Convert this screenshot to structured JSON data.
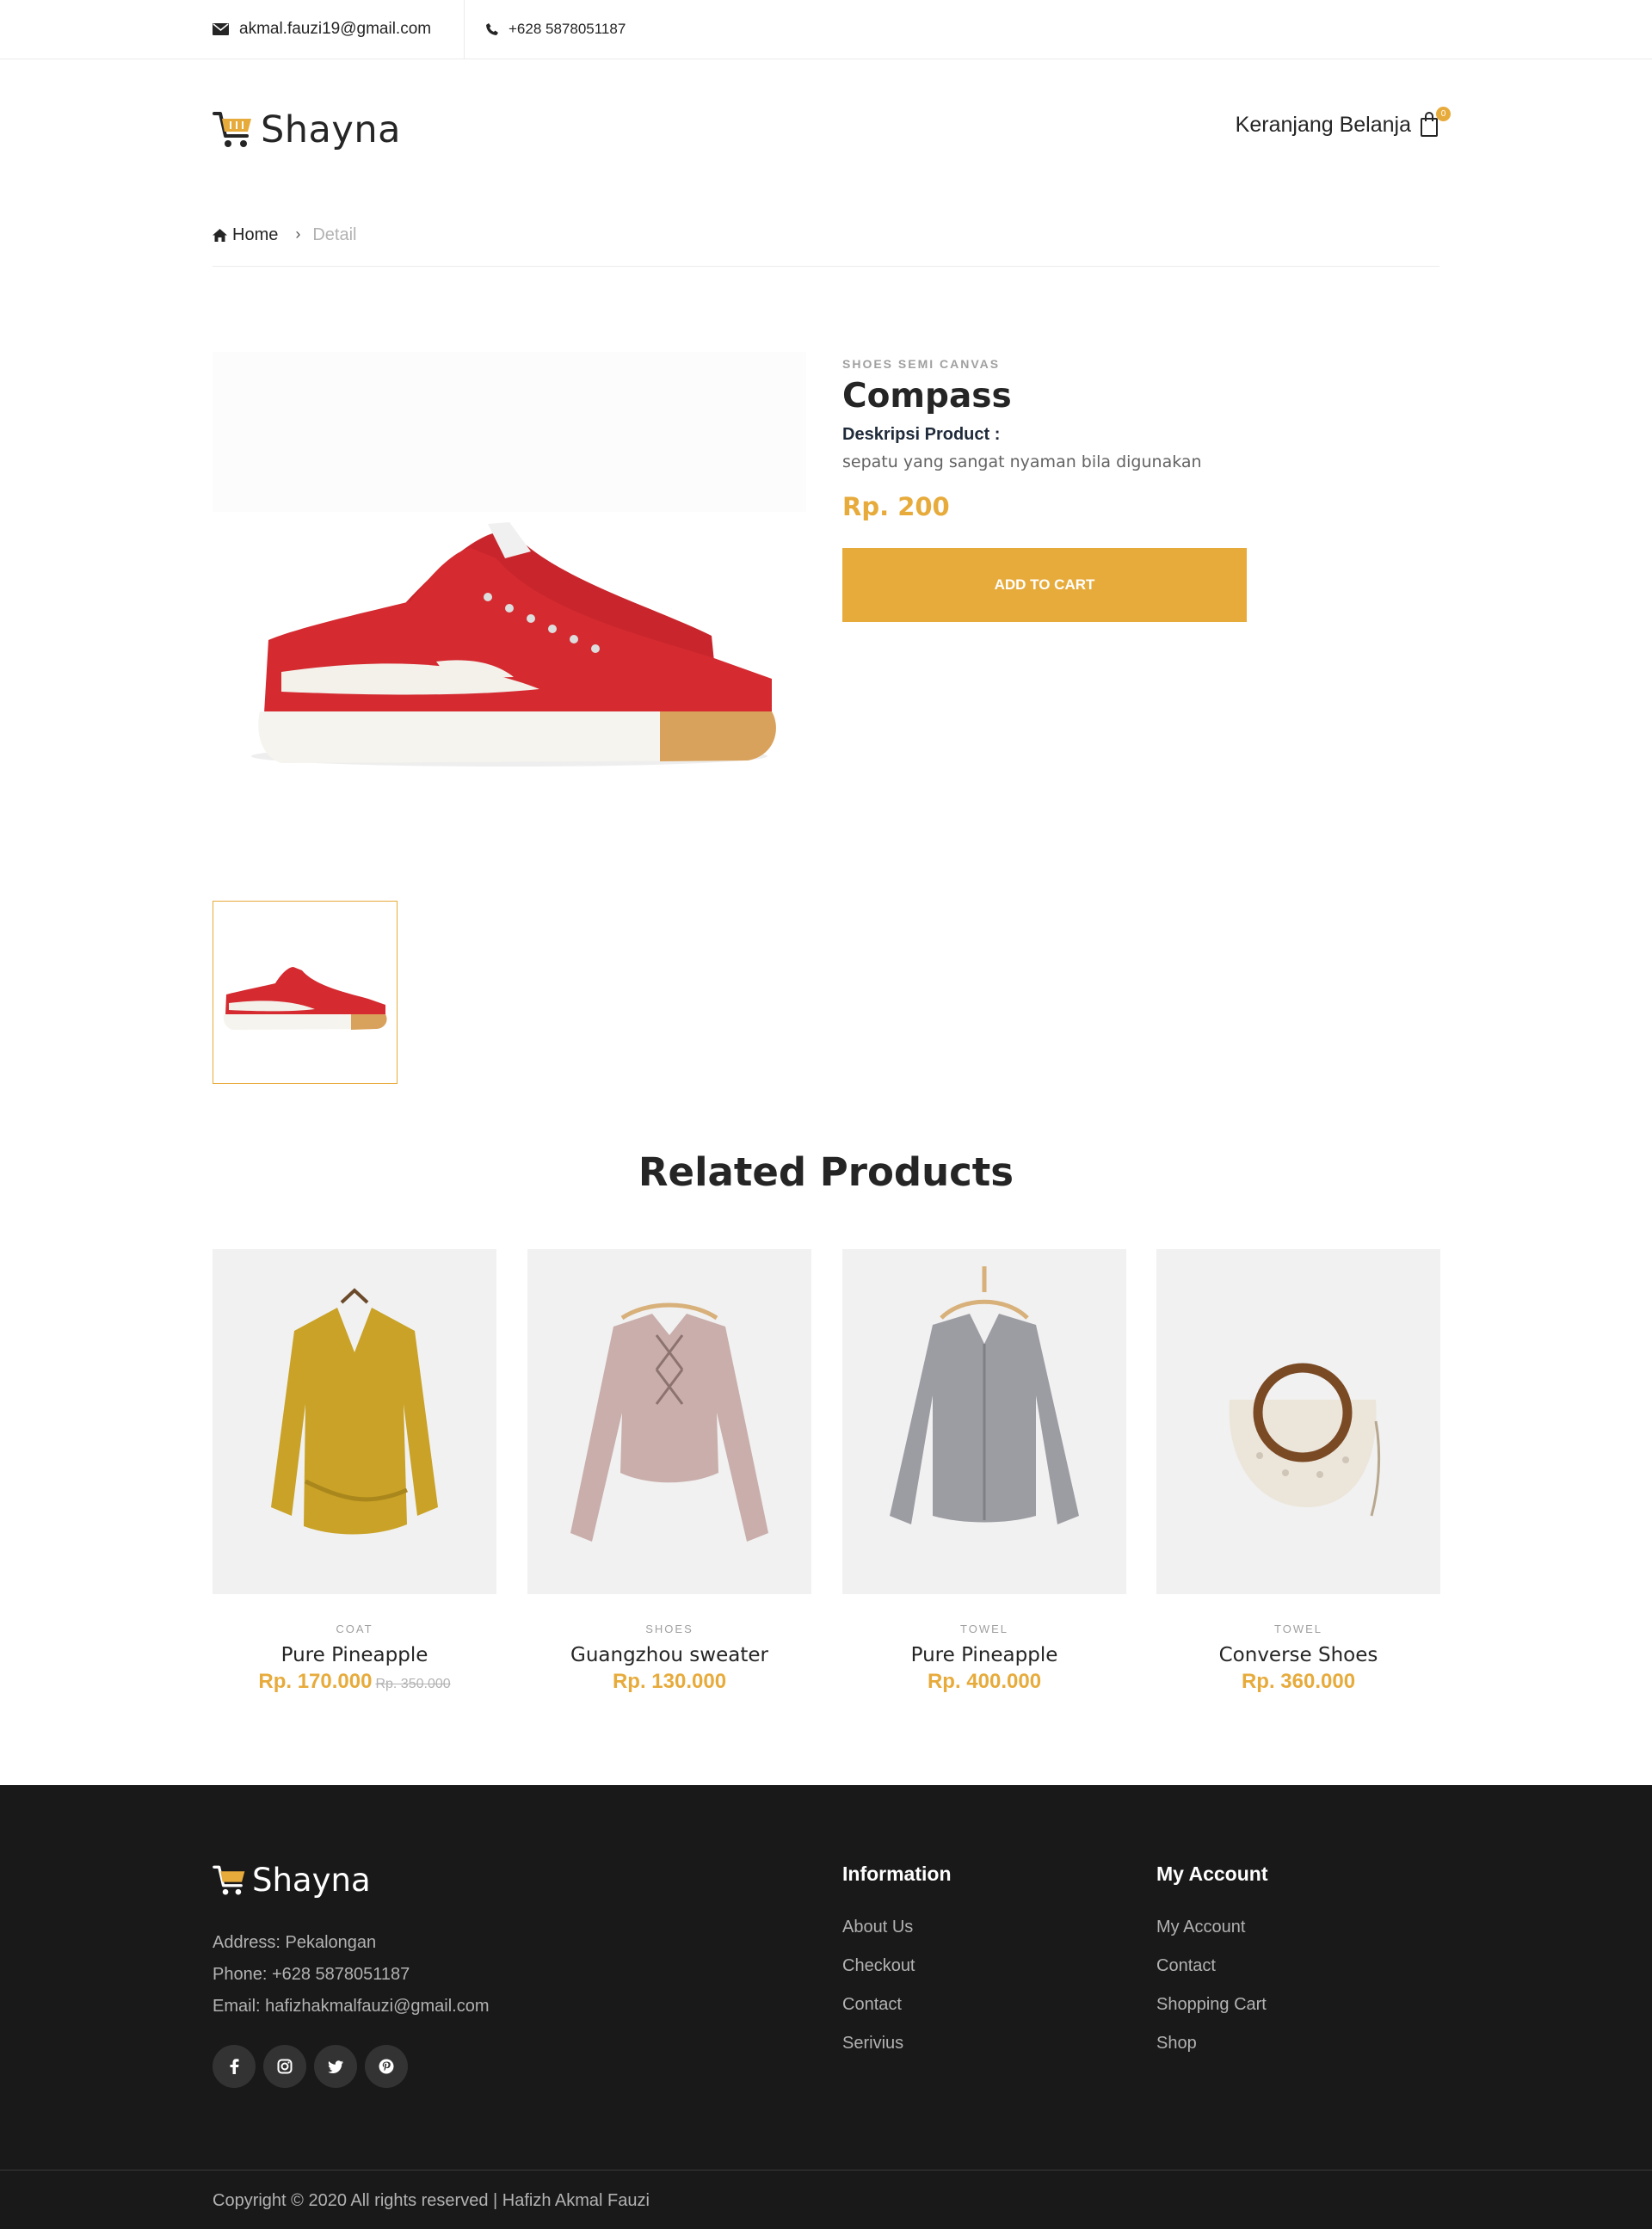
{
  "topbar": {
    "email": "akmal.fauzi19@gmail.com",
    "phone": "+628 5878051187",
    "email_icon": "envelope-icon",
    "phone_icon": "phone-icon"
  },
  "header": {
    "brand": "Shayna",
    "cart_label": "Keranjang Belanja",
    "cart_count": "0"
  },
  "breadcrumb": {
    "home": "Home",
    "current": "Detail"
  },
  "product": {
    "category": "SHOES SEMI CANVAS",
    "title": "Compass",
    "desc_label": "Deskripsi Product :",
    "description": "sepatu yang sangat nyaman bila digunakan",
    "price": "Rp. 200",
    "add_to_cart": "ADD TO CART"
  },
  "related": {
    "title": "Related Products",
    "items": [
      {
        "category": "COAT",
        "name": "Pure Pineapple",
        "price": "Rp. 170.000",
        "old_price": "Rp. 350.000"
      },
      {
        "category": "SHOES",
        "name": "Guangzhou sweater",
        "price": "Rp. 130.000"
      },
      {
        "category": "TOWEL",
        "name": "Pure Pineapple",
        "price": "Rp. 400.000"
      },
      {
        "category": "TOWEL",
        "name": "Converse Shoes",
        "price": "Rp. 360.000"
      }
    ]
  },
  "footer": {
    "brand": "Shayna",
    "address": "Address: Pekalongan",
    "phone": "Phone: +628 5878051187",
    "email": "Email: hafizhakmalfauzi@gmail.com",
    "information": {
      "title": "Information",
      "links": [
        "About Us",
        "Checkout",
        "Contact",
        "Serivius"
      ]
    },
    "account": {
      "title": "My Account",
      "links": [
        "My Account",
        "Contact",
        "Shopping Cart",
        "Shop"
      ]
    },
    "socials": [
      "facebook-icon",
      "instagram-icon",
      "twitter-icon",
      "pinterest-icon"
    ],
    "copyright": "Copyright © 2020 All rights reserved | Hafizh Akmal Fauzi"
  },
  "colors": {
    "accent": "#e7ab3c",
    "footer_bg": "#191919",
    "text": "#252525"
  }
}
